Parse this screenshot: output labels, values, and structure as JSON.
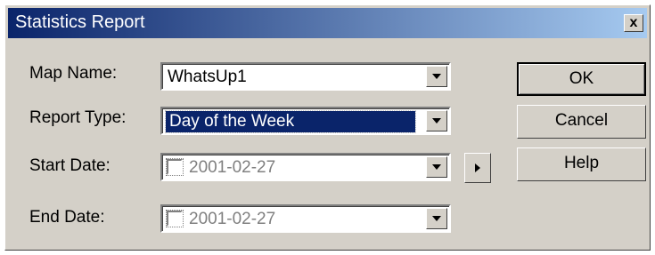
{
  "window": {
    "title": "Statistics Report",
    "close_label": "x"
  },
  "fields": {
    "map_name": {
      "label": "Map Name:",
      "value": "WhatsUp1"
    },
    "report_type": {
      "label": "Report Type:",
      "value": "Day of the Week"
    },
    "start_date": {
      "label": "Start Date:",
      "value": "2001-02-27"
    },
    "end_date": {
      "label": "End Date:",
      "value": "2001-02-27"
    }
  },
  "buttons": {
    "ok": "OK",
    "cancel": "Cancel",
    "help": "Help"
  }
}
